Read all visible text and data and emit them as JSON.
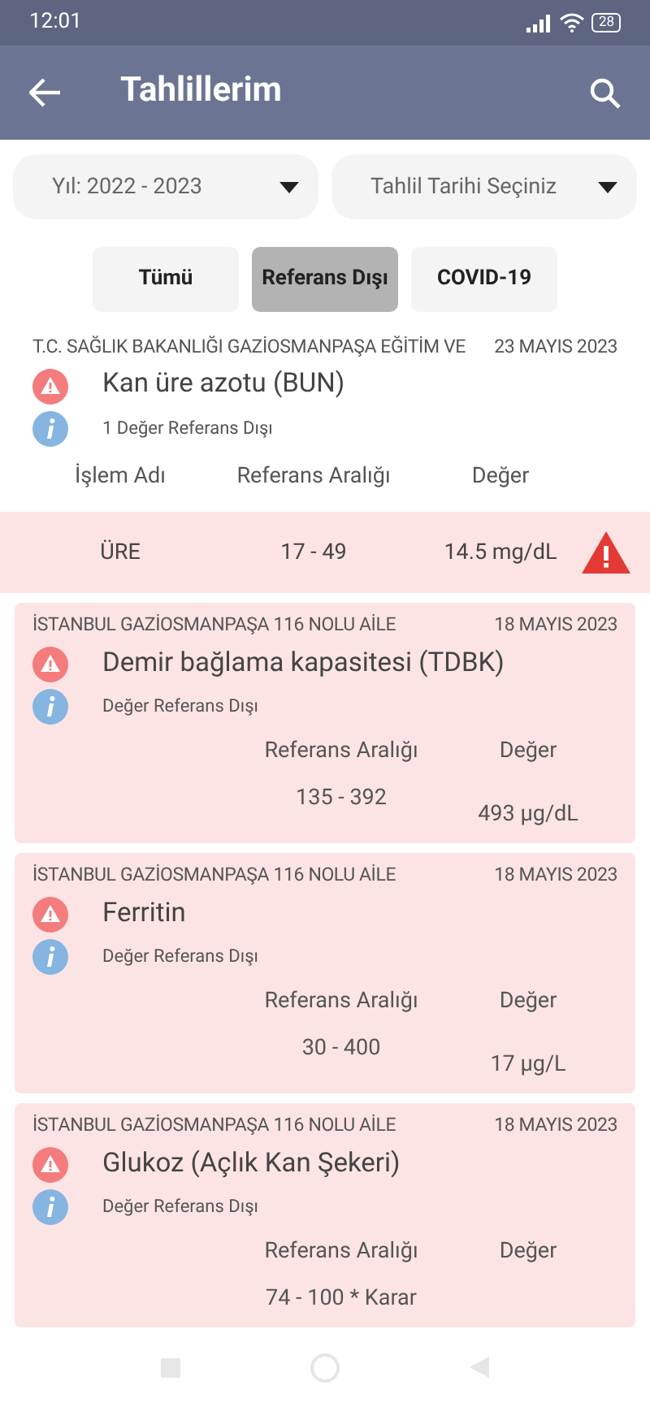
{
  "status_bar": {
    "time": "12:01",
    "battery": "28"
  },
  "app_bar": {
    "title": "Tahlillerim"
  },
  "filters": [
    {
      "label": "Yıl: 2022 - 2023"
    },
    {
      "label": "Tahlil Tarihi Seçiniz"
    }
  ],
  "tabs": [
    {
      "label": "Tümü",
      "selected": false
    },
    {
      "label": "Referans Dışı",
      "selected": true
    },
    {
      "label": "COVID-19",
      "selected": false
    }
  ],
  "results": [
    {
      "kind": "table",
      "institution": "T.C. SAĞLIK BAKANLIĞI GAZİOSMANPAŞA EĞİTİM VE",
      "date": "23 MAYIS 2023",
      "test": "Kan üre azotu (BUN)",
      "note": "1 Değer Referans Dışı",
      "columns": [
        "İşlem Adı",
        "Referans Aralığı",
        "Değer"
      ],
      "rows": [
        {
          "name": "ÜRE",
          "range": "17 - 49",
          "value": "14.5 mg/dL",
          "out_of_range": true
        }
      ]
    },
    {
      "kind": "card",
      "institution": "İSTANBUL GAZİOSMANPAŞA 116 NOLU AİLE",
      "date": "18 MAYIS 2023",
      "test": "Demir bağlama kapasitesi (TDBK)",
      "note": "Değer Referans Dışı",
      "range_label": "Referans Aralığı",
      "value_label": "Değer",
      "range": "135 - 392",
      "value": "493 µg/dL"
    },
    {
      "kind": "card",
      "institution": "İSTANBUL GAZİOSMANPAŞA 116 NOLU AİLE",
      "date": "18 MAYIS 2023",
      "test": "Ferritin",
      "note": "Değer Referans Dışı",
      "range_label": "Referans Aralığı",
      "value_label": "Değer",
      "range": "30 - 400",
      "value": "17 µg/L"
    },
    {
      "kind": "card",
      "institution": "İSTANBUL GAZİOSMANPAŞA 116 NOLU AİLE",
      "date": "18 MAYIS 2023",
      "test": "Glukoz (Açlık Kan Şekeri)",
      "note": "Değer Referans Dışı",
      "range_label": "Referans Aralığı",
      "value_label": "Değer",
      "range": "74 - 100 * Karar"
    }
  ]
}
